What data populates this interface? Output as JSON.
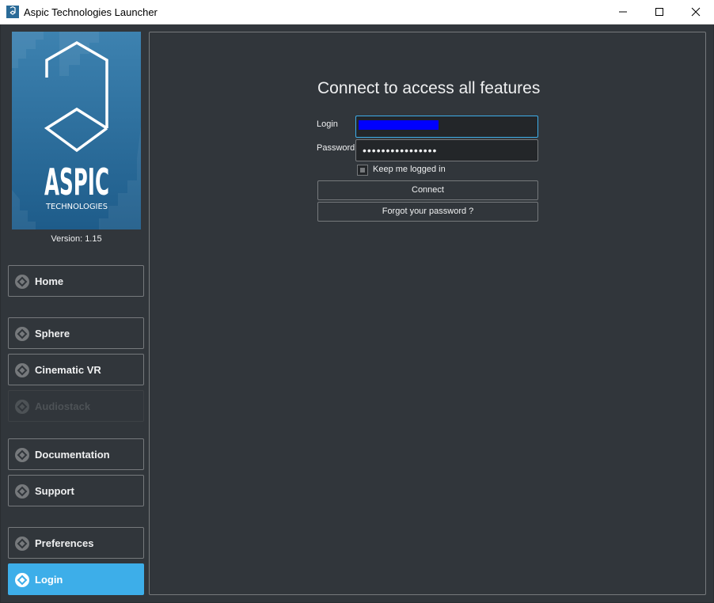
{
  "window": {
    "title": "Aspic Technologies Launcher"
  },
  "brand": {
    "name": "ASPIC",
    "tagline": "TECHNOLOGIES",
    "version": "Version: 1.15"
  },
  "nav": {
    "home": "Home",
    "sphere": "Sphere",
    "cinematic_vr": "Cinematic VR",
    "audiostack": "Audiostack",
    "documentation": "Documentation",
    "support": "Support",
    "preferences": "Preferences",
    "login": "Login",
    "active_item": "Login",
    "disabled_items": [
      "Audiostack"
    ]
  },
  "login_form": {
    "heading": "Connect to access all features",
    "login_label": "Login",
    "login_value": "",
    "password_label": "Password",
    "password_value": "••••••••••••••••",
    "keep_logged_in_label": "Keep me logged in",
    "keep_logged_in_checked": false,
    "connect_label": "Connect",
    "forgot_label": "Forgot your password ?"
  },
  "icons": {
    "app": "aspic-logo-icon",
    "nav": "diamond-icon",
    "window_controls": [
      "minimize-icon",
      "maximize-icon",
      "close-icon"
    ]
  },
  "colors": {
    "background": "#31363b",
    "border": "#76797c",
    "accent": "#3daee9",
    "text": "#eff0f1",
    "logo_blue": "#2a6b98"
  }
}
